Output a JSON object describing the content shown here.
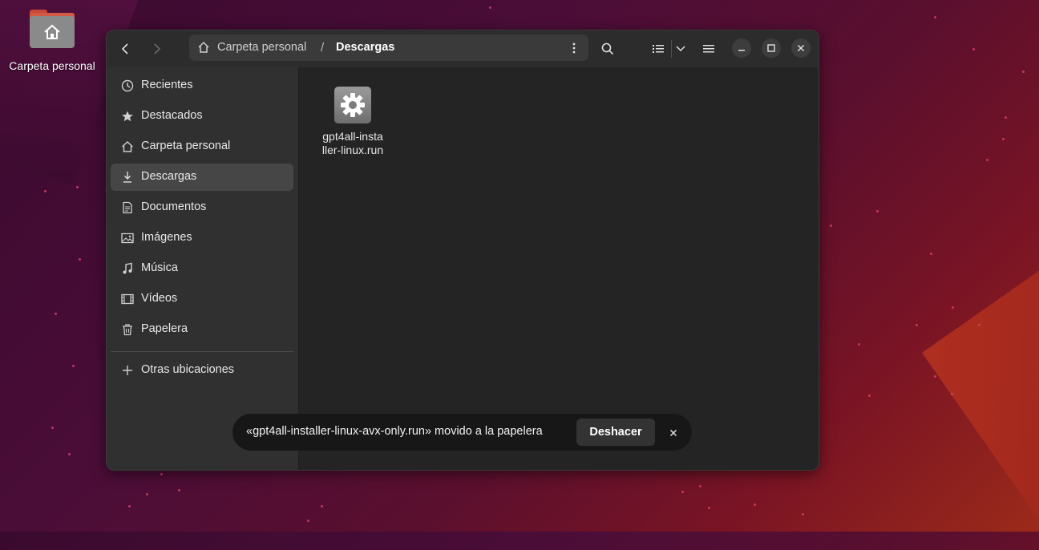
{
  "desktop": {
    "home_label": "Carpeta personal"
  },
  "pathbar": {
    "parent": "Carpeta personal",
    "separator": "/",
    "current": "Descargas"
  },
  "sidebar": {
    "items": [
      {
        "label": "Recientes",
        "icon": "clock-icon"
      },
      {
        "label": "Destacados",
        "icon": "star-icon"
      },
      {
        "label": "Carpeta personal",
        "icon": "home-icon"
      },
      {
        "label": "Descargas",
        "icon": "download-icon",
        "active": true
      },
      {
        "label": "Documentos",
        "icon": "document-icon"
      },
      {
        "label": "Imágenes",
        "icon": "image-icon"
      },
      {
        "label": "Música",
        "icon": "music-icon"
      },
      {
        "label": "Vídeos",
        "icon": "video-icon"
      },
      {
        "label": "Papelera",
        "icon": "trash-icon"
      }
    ],
    "other_locations": "Otras ubicaciones"
  },
  "files": [
    {
      "name": "gpt4all-installer-linux.run",
      "icon": "gear-icon"
    }
  ],
  "toast": {
    "message": "«gpt4all-installer-linux-avx-only.run» movido a la papelera",
    "action": "Deshacer"
  },
  "colors": {
    "window_bg": "#242424",
    "sidebar_bg": "#303030",
    "active_item": "#464646",
    "toast_bg": "#171717"
  }
}
